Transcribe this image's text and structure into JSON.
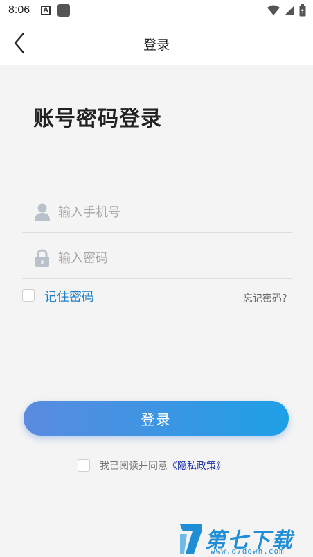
{
  "status_bar": {
    "time": "8:06",
    "a_badge": "A"
  },
  "header": {
    "title": "登录"
  },
  "main": {
    "heading": "账号密码登录",
    "phone_placeholder": "输入手机号",
    "password_placeholder": "输入密码",
    "remember_label": "记住密码",
    "forgot_link": "忘记密码？",
    "login_button": "登录",
    "agree_text": "我已阅读并同意",
    "policy_link": "《隐私政策》"
  },
  "watermark": {
    "title": "第七下载站",
    "url": "www.d7down.com"
  },
  "colors": {
    "accent": "#1f7fc9",
    "button_start": "#5a8be0",
    "button_end": "#1ea0e6",
    "policy_link": "#1a2fa8",
    "background": "#f4f4f4"
  }
}
